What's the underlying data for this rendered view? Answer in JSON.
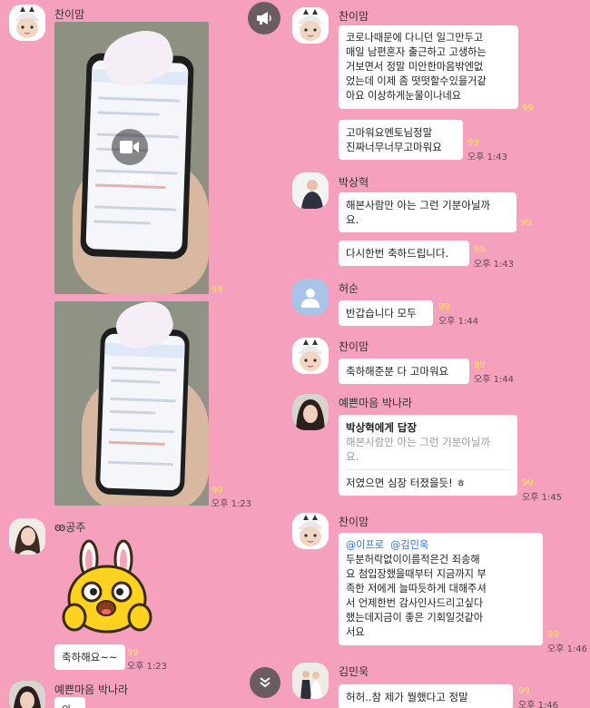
{
  "left_chat": {
    "msg1": {
      "sender": "찬이맘",
      "video_size": "0.83MB",
      "unread": "99",
      "unread2": "99",
      "time": "오후 1:23"
    },
    "msg2": {
      "sender": "ꙭ공주",
      "sticker_icon": "emoticon-sticker",
      "text": "축하해요~~",
      "unread": "99",
      "time": "오후 1:23"
    },
    "msg3": {
      "sender": "예쁜마음 박나라",
      "text": "와.."
    }
  },
  "right_chat": {
    "m1": {
      "sender": "찬이맘",
      "b1": "코로나때문에 다니던 일그만두고\n매일 남편혼자 출근하고 고생하는\n거보면서 정말 미안한마음밖엔없\n었는데 이제 좀 떳떳할수있을거같\n아요 이상하게눈물이나네요",
      "u1": "99",
      "b2": "고마워요멘토님정말\n진짜너무너무고마워요",
      "u2": "99",
      "time": "오후 1:43"
    },
    "m2": {
      "sender": "박상혁",
      "b1": "해본사람만 아는 그런 기분아닐까\n요.",
      "u1": "99",
      "b2": "다시한번 축하드립니다.",
      "u2": "99",
      "time": "오후 1:43"
    },
    "m3": {
      "sender": "허순",
      "b1": "반갑습니다 모두",
      "u1": "99",
      "time": "오후 1:44"
    },
    "m4": {
      "sender": "찬이맘",
      "b1": "축하해준분 다 고마워요",
      "u1": "99",
      "time": "오후 1:44"
    },
    "m5": {
      "sender": "예쁜마음 박나라",
      "reply_label": "박상혁에게 답장",
      "reply_quote": "해본사람만 아는 그런 기분아닐까\n요.",
      "reply_text": "저였으면 심장 터졌을듯! ㅎ",
      "u1": "99",
      "time": "오후 1:45"
    },
    "m6": {
      "sender": "찬이맘",
      "mentions": "@이프로  @김민욱",
      "body": "두분허락없이이름적은건 죄송해\n요 첨입장했을때부터 지금까지 부\n족한 저에게 늘따듯하게 대해주셔\n서 언제한번 감사인사드리고싶다\n했는데지금이 좋은 기회일것같아\n서요",
      "u1": "99",
      "time": "오후 1:46"
    },
    "m7": {
      "sender": "김민욱",
      "b1": "허허..참 제가 뭘했다고 정말",
      "u1": "99",
      "time": "오후 1:46"
    }
  },
  "icons": {
    "announce": "megaphone-icon",
    "scroll_down": "chevron-down-icon",
    "play": "video-camera-icon"
  },
  "colors": {
    "background": "#f5a0bd",
    "unread": "#ffe55a",
    "mention": "#2f6fd6"
  }
}
